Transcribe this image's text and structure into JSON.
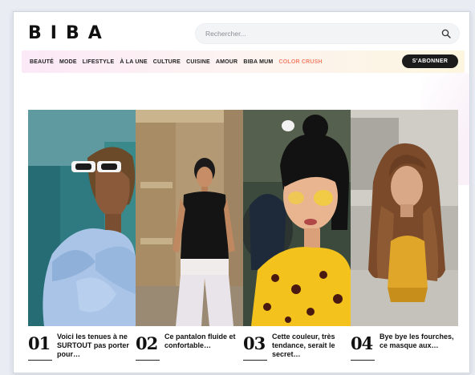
{
  "header": {
    "logo": "BIBA",
    "search_placeholder": "Rechercher..."
  },
  "nav": {
    "items": [
      {
        "label": "BEAUTÉ"
      },
      {
        "label": "MODE"
      },
      {
        "label": "LIFESTYLE"
      },
      {
        "label": "À LA UNE"
      },
      {
        "label": "CULTURE"
      },
      {
        "label": "CUISINE"
      },
      {
        "label": "AMOUR"
      },
      {
        "label": "BIBA MUM"
      },
      {
        "label": "COLOR CRUSH"
      }
    ],
    "subscribe_label": "S'ABONNER"
  },
  "articles": [
    {
      "number": "01",
      "title": "Voici les tenues à ne SURTOUT pas porter pour…"
    },
    {
      "number": "02",
      "title": "Ce pantalon fluide et confortable…"
    },
    {
      "number": "03",
      "title": "Cette couleur, très tendance, serait le secret…"
    },
    {
      "number": "04",
      "title": "Bye bye les fourches, ce masque aux…"
    }
  ],
  "colors": {
    "accent": "#f4816a",
    "button_bg": "#1b1b1b",
    "nav_gradient_start": "#fbe9f7",
    "nav_gradient_end": "#fcf6e0"
  }
}
